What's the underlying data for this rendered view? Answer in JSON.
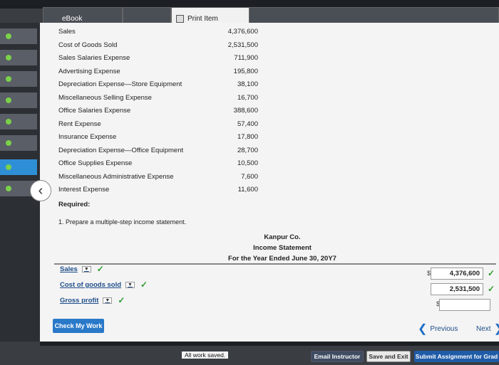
{
  "tabs": {
    "ebook": "eBook",
    "print": "Print Item"
  },
  "accounts": [
    {
      "name": "Sales",
      "amount": "4,376,600"
    },
    {
      "name": "Cost of Goods Sold",
      "amount": "2,531,500"
    },
    {
      "name": "Sales Salaries Expense",
      "amount": "711,900"
    },
    {
      "name": "Advertising Expense",
      "amount": "195,800"
    },
    {
      "name": "Depreciation Expense—Store Equipment",
      "amount": "38,100"
    },
    {
      "name": "Miscellaneous Selling Expense",
      "amount": "16,700"
    },
    {
      "name": "Office Salaries Expense",
      "amount": "388,600"
    },
    {
      "name": "Rent Expense",
      "amount": "57,400"
    },
    {
      "name": "Insurance Expense",
      "amount": "17,800"
    },
    {
      "name": "Depreciation Expense—Office Equipment",
      "amount": "28,700"
    },
    {
      "name": "Office Supplies Expense",
      "amount": "10,500"
    },
    {
      "name": "Miscellaneous Administrative Expense",
      "amount": "7,600"
    },
    {
      "name": "Interest Expense",
      "amount": "11,600"
    }
  ],
  "required_label": "Required:",
  "instruction": "1.  Prepare a multiple-step income statement.",
  "statement": {
    "company": "Kanpur Co.",
    "title": "Income Statement",
    "period": "For the Year Ended June 30, 20Y7"
  },
  "lines": {
    "sales": {
      "label": "Sales",
      "value": "4,376,600"
    },
    "cogs": {
      "label": "Cost of goods sold",
      "value": "2,531,500"
    },
    "gross": {
      "label": "Gross profit",
      "value": ""
    }
  },
  "currency_symbol": "$",
  "buttons": {
    "check_work": "Check My Work",
    "previous": "Previous",
    "next": "Next",
    "email": "Email Instructor",
    "save_exit": "Save and Exit",
    "submit": "Submit Assignment for Grad"
  },
  "status": {
    "saved": "All work saved."
  },
  "colors": {
    "check": "#2e9a2e",
    "accent": "#2a79c9",
    "active_nav": "#2f8fd6"
  }
}
